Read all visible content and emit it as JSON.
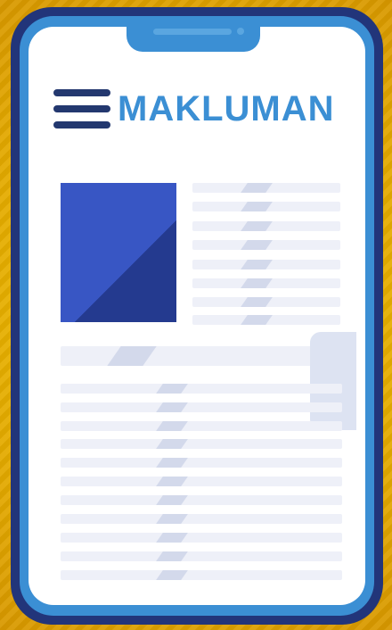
{
  "header": {
    "title": "MAKLUMAN",
    "menu_icon": "hamburger-menu-icon"
  },
  "colors": {
    "background": "#e8b400",
    "phone_frame": "#22357a",
    "phone_body": "#3b8fd4",
    "title_text": "#3b8fd4",
    "menu_icon": "#23386f",
    "image_block": "#3856c4"
  }
}
